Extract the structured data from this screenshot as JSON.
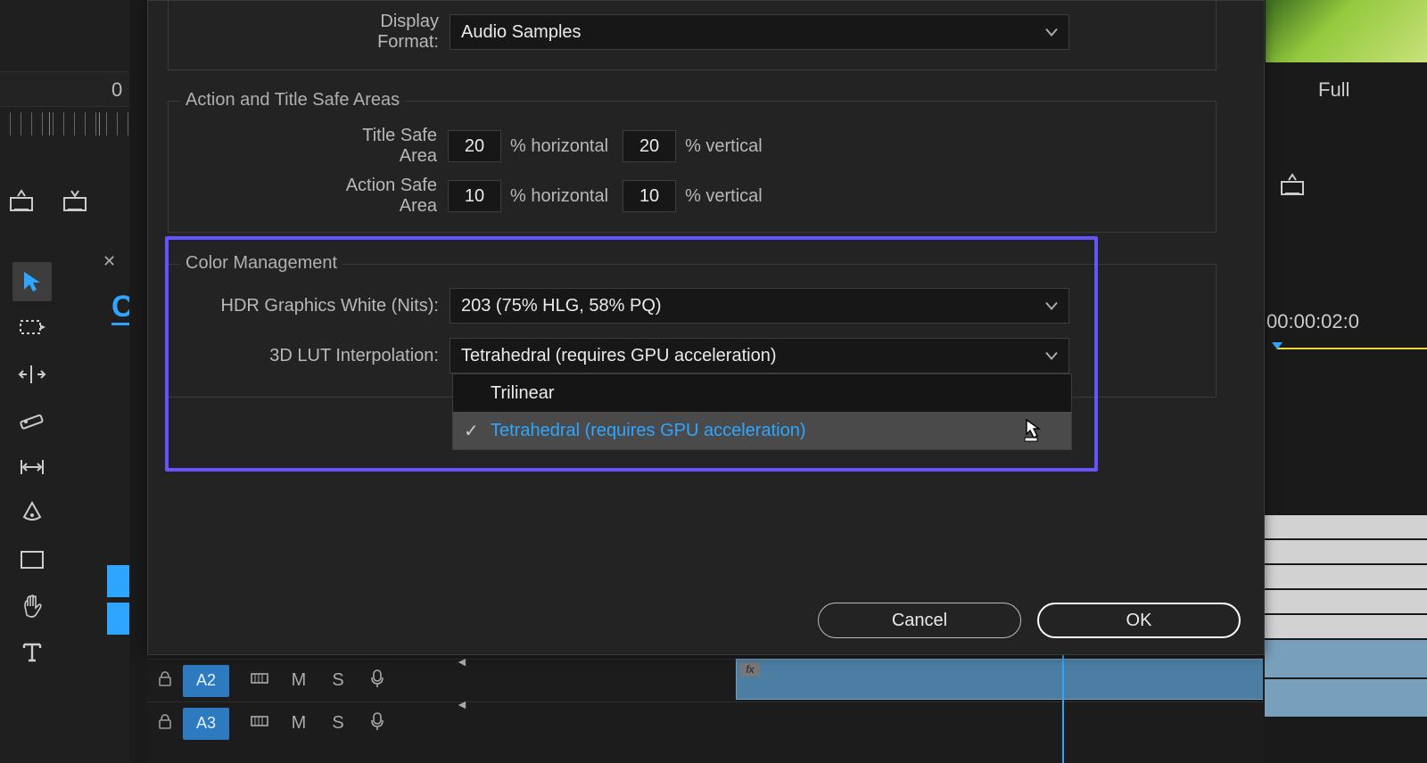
{
  "left": {
    "timecode_fragment": "0",
    "panel_tab_char": "C"
  },
  "dialog": {
    "display_format": {
      "label": "Display Format:",
      "value": "Audio Samples"
    },
    "safe_areas": {
      "group_label": "Action and Title Safe Areas",
      "title_label": "Title Safe Area",
      "action_label": "Action Safe Area",
      "title_h": "20",
      "title_v": "20",
      "action_h": "10",
      "action_v": "10",
      "pct_h": "% horizontal",
      "pct_v": "% vertical"
    },
    "color_mgmt": {
      "group_label": "Color Management",
      "hdr_label": "HDR Graphics White (Nits):",
      "hdr_value": "203 (75% HLG, 58% PQ)",
      "lut_label": "3D LUT Interpolation:",
      "lut_value": "Tetrahedral (requires GPU acceleration)",
      "lut_options": [
        "Trilinear",
        "Tetrahedral (requires GPU acceleration)"
      ],
      "lut_selected_index": 1,
      "lut_hover_index": 1
    },
    "buttons": {
      "cancel": "Cancel",
      "ok": "OK"
    }
  },
  "right": {
    "quality_label": "Full",
    "timecode_fragment": "00:00:02:0"
  },
  "timeline": {
    "tracks": [
      {
        "label": "A2",
        "m": "M",
        "s": "S"
      },
      {
        "label": "A3",
        "m": "M",
        "s": "S"
      }
    ],
    "fx_label": "fx"
  }
}
